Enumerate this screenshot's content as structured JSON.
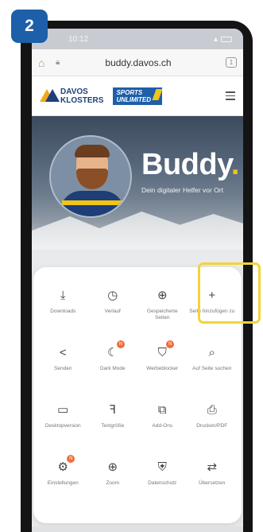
{
  "step_badge": "2",
  "status_bar": {
    "time": "10:12"
  },
  "url_bar": {
    "url": "buddy.davos.ch",
    "tabs_count": "1"
  },
  "site_header": {
    "brand_line1": "DAVOS",
    "brand_line2": "KLOSTERS",
    "sports_line1": "SPORTS",
    "sports_line2": "UNLIMITED"
  },
  "hero": {
    "title": "Buddy",
    "title_dot": ".",
    "subtitle": "Dein digitaler Helfer vor Ort"
  },
  "menu": {
    "items": [
      {
        "label": "Downloads",
        "icon": "download-icon"
      },
      {
        "label": "Verlauf",
        "icon": "history-icon"
      },
      {
        "label": "Gespeicherte Seiten",
        "icon": "saved-pages-icon"
      },
      {
        "label": "Seite hinzufügen zu",
        "icon": "plus-icon"
      },
      {
        "label": "Senden",
        "icon": "share-icon"
      },
      {
        "label": "Dark Mode",
        "icon": "dark-mode-icon",
        "badge": "N"
      },
      {
        "label": "Werbeblocker",
        "icon": "adblock-icon",
        "badge": "N"
      },
      {
        "label": "Auf Seite suchen",
        "icon": "find-in-page-icon"
      },
      {
        "label": "Desktopversion",
        "icon": "desktop-icon"
      },
      {
        "label": "Textgröße",
        "icon": "text-size-icon"
      },
      {
        "label": "Add-Ons",
        "icon": "addons-icon"
      },
      {
        "label": "Drucken/PDF",
        "icon": "print-icon"
      },
      {
        "label": "Einstellungen",
        "icon": "settings-icon",
        "badge": "N"
      },
      {
        "label": "Zoom",
        "icon": "zoom-icon"
      },
      {
        "label": "Datenschutz",
        "icon": "privacy-icon"
      },
      {
        "label": "Übersetzen",
        "icon": "translate-icon"
      }
    ]
  },
  "colors": {
    "badge_blue": "#1d5fa8",
    "highlight": "#f2d43a",
    "accent_orange": "#ef6c3c"
  }
}
